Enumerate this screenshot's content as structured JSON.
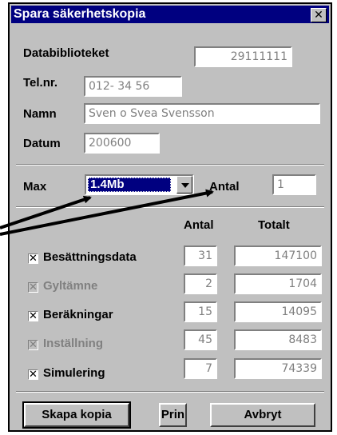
{
  "window": {
    "title": "Spara säkerhetskopia",
    "close_glyph": "✕"
  },
  "form": {
    "databibliotek_label": "Databiblioteket",
    "databibliotek_value": "29111111",
    "tel_label": "Tel.nr.",
    "tel_value": "012- 34 56",
    "namn_label": "Namn",
    "namn_value": "Sven o Svea Svensson",
    "datum_label": "Datum",
    "datum_value": "200600",
    "max_label": "Max",
    "max_value": "1.4Mb",
    "antal_label": "Antal",
    "antal_value": "1"
  },
  "table": {
    "col_antal": "Antal",
    "col_totalt": "Totalt",
    "rows": [
      {
        "label": "Besättningsdata",
        "checked": true,
        "enabled": true,
        "antal": "31",
        "totalt": "147100"
      },
      {
        "label": "Gyltämne",
        "checked": true,
        "enabled": false,
        "antal": "2",
        "totalt": "1704"
      },
      {
        "label": "Beräkningar",
        "checked": true,
        "enabled": true,
        "antal": "15",
        "totalt": "14095"
      },
      {
        "label": "Inställning",
        "checked": true,
        "enabled": false,
        "antal": "45",
        "totalt": "8483"
      },
      {
        "label": "Simulering",
        "checked": true,
        "enabled": true,
        "antal": "7",
        "totalt": "74339"
      }
    ]
  },
  "buttons": {
    "create": "Skapa kopia",
    "print": "Prin",
    "cancel": "Avbryt"
  },
  "icons": {
    "close": "close-icon",
    "dropdown": "chevron-down-icon",
    "check": "check-icon",
    "arrow": "annotation-arrow"
  }
}
